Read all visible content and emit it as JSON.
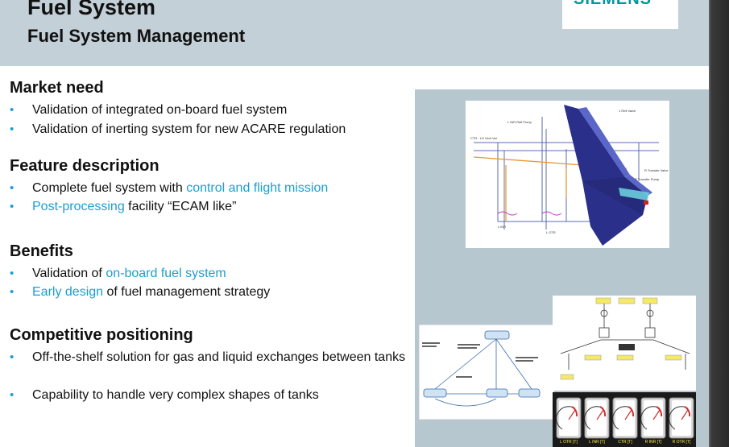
{
  "header": {
    "title": "Fuel System",
    "subtitle": "Fuel System Management",
    "logo": "SIEMENS"
  },
  "sections": [
    {
      "title": "Market need",
      "bullets": [
        [
          {
            "t": "Validation of integrated on-board fuel system",
            "hl": false
          }
        ],
        [
          {
            "t": "Validation of inerting system for new ACARE regulation",
            "hl": false
          }
        ]
      ]
    },
    {
      "title": "Feature description",
      "bullets": [
        [
          {
            "t": "Complete fuel system with ",
            "hl": false
          },
          {
            "t": "control and flight mission",
            "hl": true
          }
        ],
        [
          {
            "t": "Post-processing",
            "hl": true
          },
          {
            "t": " facility “ECAM like”",
            "hl": false
          }
        ]
      ]
    },
    {
      "title": "Benefits",
      "bullets": [
        [
          {
            "t": "Validation of ",
            "hl": false
          },
          {
            "t": "on-board fuel system",
            "hl": true
          }
        ],
        [
          {
            "t": "Early design",
            "hl": true
          },
          {
            "t": " of fuel management strategy",
            "hl": false
          }
        ]
      ]
    },
    {
      "title": "Competitive positioning",
      "bullets": [
        [
          {
            "t": "Off-the-shelf solution for gas and liquid exchanges between tanks",
            "hl": false
          }
        ],
        [
          {
            "t": "Capability to handle very complex shapes of tanks",
            "hl": false
          }
        ]
      ]
    }
  ],
  "diagram_labels": {
    "refuel_pump": "L INR Refl Pump",
    "fuel_valve": "1 Refl Valve",
    "ctr_vent": "CTR - LH Vent Val",
    "l_inr": "L INR",
    "l_otr": "L OTR",
    "r_transfer": "R Transfer Valve",
    "r_transfer_pump": "R Transfer Pump"
  },
  "gauges": [
    "L OTR [T]",
    "L INR [T]",
    "CTR [T]",
    "R INR [T]",
    "R OTR [T]"
  ],
  "colors": {
    "header_bg": "#c3d0d8",
    "panel_bg": "#b7c7d0",
    "accent": "#1a9fd1",
    "logo": "#009999"
  }
}
